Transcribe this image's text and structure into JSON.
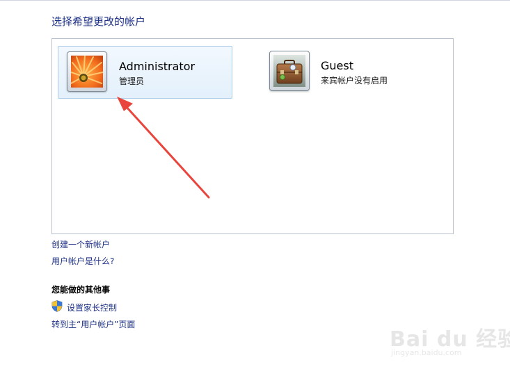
{
  "page": {
    "title": "选择希望更改的帐户"
  },
  "accounts": [
    {
      "name": "Administrator",
      "role": "管理员",
      "icon": "flower-avatar-icon",
      "selected": true
    },
    {
      "name": "Guest",
      "role": "来宾帐户没有启用",
      "icon": "suitcase-avatar-icon",
      "selected": false
    }
  ],
  "links": {
    "create_account": "创建一个新帐户",
    "what_is_account": "用户帐户是什么?"
  },
  "other_tasks": {
    "heading": "您能做的其他事",
    "parental_controls": "设置家长控制",
    "goto_main": "转到主“用户帐户”页面"
  },
  "annotation": {
    "arrow_color": "#e8453c"
  },
  "watermark": {
    "text": "Bai du 经验",
    "url": "jingyan.baidu.com"
  },
  "colors": {
    "link": "#1e3287",
    "selected_tile_border": "#a9cbe9",
    "panel_border": "#b9c1cb"
  }
}
